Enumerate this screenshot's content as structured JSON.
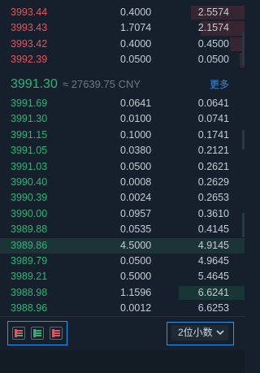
{
  "orderbook": {
    "asks": [
      {
        "price": "3993.44",
        "amount": "0.4000",
        "total": "2.5574",
        "depth": 0.22
      },
      {
        "price": "3993.43",
        "amount": "1.7074",
        "total": "2.1574",
        "depth": 0.18
      },
      {
        "price": "3993.42",
        "amount": "0.4000",
        "total": "0.4500",
        "depth": 0.06
      },
      {
        "price": "3992.39",
        "amount": "0.0500",
        "total": "0.0500",
        "depth": 0.02
      }
    ],
    "mid": {
      "price": "3991.30",
      "approx": "≈ 27639.75 CNY",
      "more_label": "更多"
    },
    "bids": [
      {
        "price": "3991.69",
        "amount": "0.0641",
        "total": "0.0641",
        "depth": 0.0
      },
      {
        "price": "3991.30",
        "amount": "0.0100",
        "total": "0.0741",
        "depth": 0.0
      },
      {
        "price": "3991.15",
        "amount": "0.1000",
        "total": "0.1741",
        "depth": 0.0
      },
      {
        "price": "3991.05",
        "amount": "0.0380",
        "total": "0.2121",
        "depth": 0.0
      },
      {
        "price": "3991.03",
        "amount": "0.0500",
        "total": "0.2621",
        "depth": 0.0
      },
      {
        "price": "3990.40",
        "amount": "0.0008",
        "total": "0.2629",
        "depth": 0.0
      },
      {
        "price": "3990.39",
        "amount": "0.0024",
        "total": "0.2653",
        "depth": 0.0
      },
      {
        "price": "3990.00",
        "amount": "0.0957",
        "total": "0.3610",
        "depth": 0.0
      },
      {
        "price": "3989.88",
        "amount": "0.0535",
        "total": "0.4145",
        "depth": 0.0
      },
      {
        "price": "3989.86",
        "amount": "4.5000",
        "total": "4.9145",
        "depth": 0.0,
        "highlight": true
      },
      {
        "price": "3989.79",
        "amount": "0.0500",
        "total": "4.9645",
        "depth": 0.0
      },
      {
        "price": "3989.21",
        "amount": "0.5000",
        "total": "5.4645",
        "depth": 0.0
      },
      {
        "price": "3988.98",
        "amount": "1.1596",
        "total": "6.6241",
        "depth": 0.27
      },
      {
        "price": "3988.96",
        "amount": "0.0012",
        "total": "6.6253",
        "depth": 0.0
      }
    ]
  },
  "controls": {
    "layout_buttons": [
      {
        "name": "layout-both-icon",
        "colors": [
          "#e4545c",
          "#2db573"
        ]
      },
      {
        "name": "layout-bids-icon",
        "colors": [
          "#2db573",
          "#2db573"
        ]
      },
      {
        "name": "layout-asks-icon",
        "colors": [
          "#e4545c",
          "#e4545c"
        ]
      }
    ],
    "precision_label": "2位小数",
    "precision_icon": "chevron-down-icon"
  },
  "colors": {
    "ask": "#e4545c",
    "bid": "#2db573",
    "accent": "#2e95e6",
    "background": "#16202c"
  }
}
